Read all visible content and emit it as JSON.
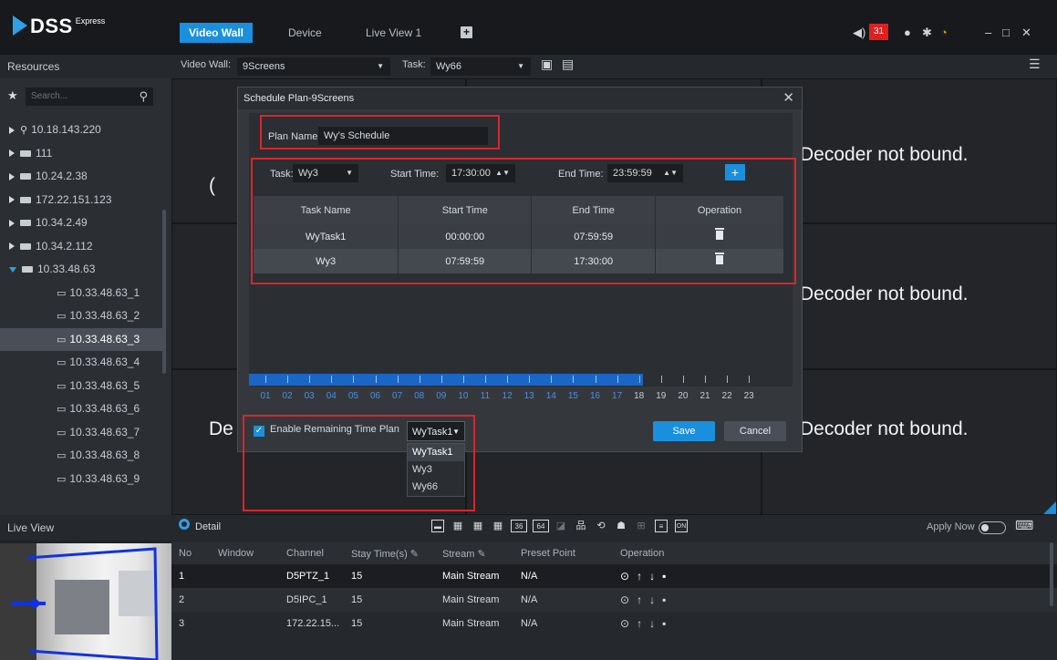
{
  "app": {
    "brand": "DSS",
    "edition": "Express"
  },
  "nav": {
    "tabs": [
      {
        "label": "Video Wall",
        "active": true
      },
      {
        "label": "Device",
        "active": false
      },
      {
        "label": "Live View 1",
        "active": false
      }
    ],
    "alarm_count": "31"
  },
  "toolbar": {
    "wall_label": "Video Wall:",
    "wall_value": "9Screens",
    "task_label": "Task:",
    "task_value": "Wy66"
  },
  "sidebar": {
    "title": "Resources",
    "search_placeholder": "Search...",
    "items": [
      {
        "label": "10.18.143.220",
        "kind": "server",
        "level": 0,
        "expanded": false
      },
      {
        "label": "111",
        "kind": "encoder",
        "level": 0,
        "expanded": false
      },
      {
        "label": "10.24.2.38",
        "kind": "encoder",
        "level": 0,
        "expanded": false
      },
      {
        "label": "172.22.151.123",
        "kind": "device",
        "level": 0,
        "expanded": false
      },
      {
        "label": "10.34.2.49",
        "kind": "device",
        "level": 0,
        "expanded": false
      },
      {
        "label": "10.34.2.112",
        "kind": "encoder",
        "level": 0,
        "expanded": false
      },
      {
        "label": "10.33.48.63",
        "kind": "device",
        "level": 0,
        "expanded": true
      },
      {
        "label": "10.33.48.63_1",
        "kind": "channel",
        "level": 1
      },
      {
        "label": "10.33.48.63_2",
        "kind": "channel",
        "level": 1
      },
      {
        "label": "10.33.48.63_3",
        "kind": "channel",
        "level": 1,
        "selected": true
      },
      {
        "label": "10.33.48.63_4",
        "kind": "channel",
        "level": 1
      },
      {
        "label": "10.33.48.63_5",
        "kind": "channel",
        "level": 1
      },
      {
        "label": "10.33.48.63_6",
        "kind": "channel",
        "level": 1
      },
      {
        "label": "10.33.48.63_7",
        "kind": "channel",
        "level": 1
      },
      {
        "label": "10.33.48.63_8",
        "kind": "channel",
        "level": 1
      },
      {
        "label": "10.33.48.63_9",
        "kind": "channel",
        "level": 1
      }
    ],
    "live_view_title": "Live View"
  },
  "wall": {
    "message": "Decoder not bound.",
    "partial_left": "De"
  },
  "modal": {
    "title": "Schedule Plan-9Screens",
    "plan_name_label": "Plan Name:",
    "plan_name_value": "Wy's Schedule",
    "task_label": "Task:",
    "task_value": "Wy3",
    "start_label": "Start Time:",
    "start_value": "17:30:00",
    "end_label": "End Time:",
    "end_value": "23:59:59",
    "columns": [
      "Task Name",
      "Start Time",
      "End Time",
      "Operation"
    ],
    "rows": [
      {
        "task": "WyTask1",
        "start": "00:00:00",
        "end": "07:59:59"
      },
      {
        "task": "Wy3",
        "start": "07:59:59",
        "end": "17:30:00"
      }
    ],
    "timeline_hours": [
      "01",
      "02",
      "03",
      "04",
      "05",
      "06",
      "07",
      "08",
      "09",
      "10",
      "11",
      "12",
      "13",
      "14",
      "15",
      "16",
      "17",
      "18",
      "19",
      "20",
      "21",
      "22",
      "23"
    ],
    "timeline_filled_until": 17,
    "enable_label": "Enable Remaining Time Plan",
    "enable_checked": true,
    "remaining_value": "WyTask1",
    "remaining_options": [
      "WyTask1",
      "Wy3",
      "Wy66"
    ],
    "save_label": "Save",
    "cancel_label": "Cancel"
  },
  "detail": {
    "title": "Detail",
    "layout_36": "36",
    "layout_64": "64",
    "apply_now": "Apply Now",
    "columns": [
      "No",
      "Window",
      "Channel",
      "Stay Time(s)",
      "Stream",
      "Preset Point",
      "Operation"
    ],
    "rows": [
      {
        "no": "1",
        "window": "",
        "channel": "D5PTZ_1",
        "stay": "15",
        "stream": "Main Stream",
        "preset": "N/A"
      },
      {
        "no": "2",
        "window": "",
        "channel": "D5IPC_1",
        "stay": "15",
        "stream": "Main Stream",
        "preset": "N/A"
      },
      {
        "no": "3",
        "window": "",
        "channel": "172.22.15...",
        "stay": "15",
        "stream": "Main Stream",
        "preset": "N/A"
      }
    ]
  },
  "colors": {
    "accent": "#1a8fdd",
    "highlight": "#d9262b",
    "alarm": "#e02020"
  }
}
